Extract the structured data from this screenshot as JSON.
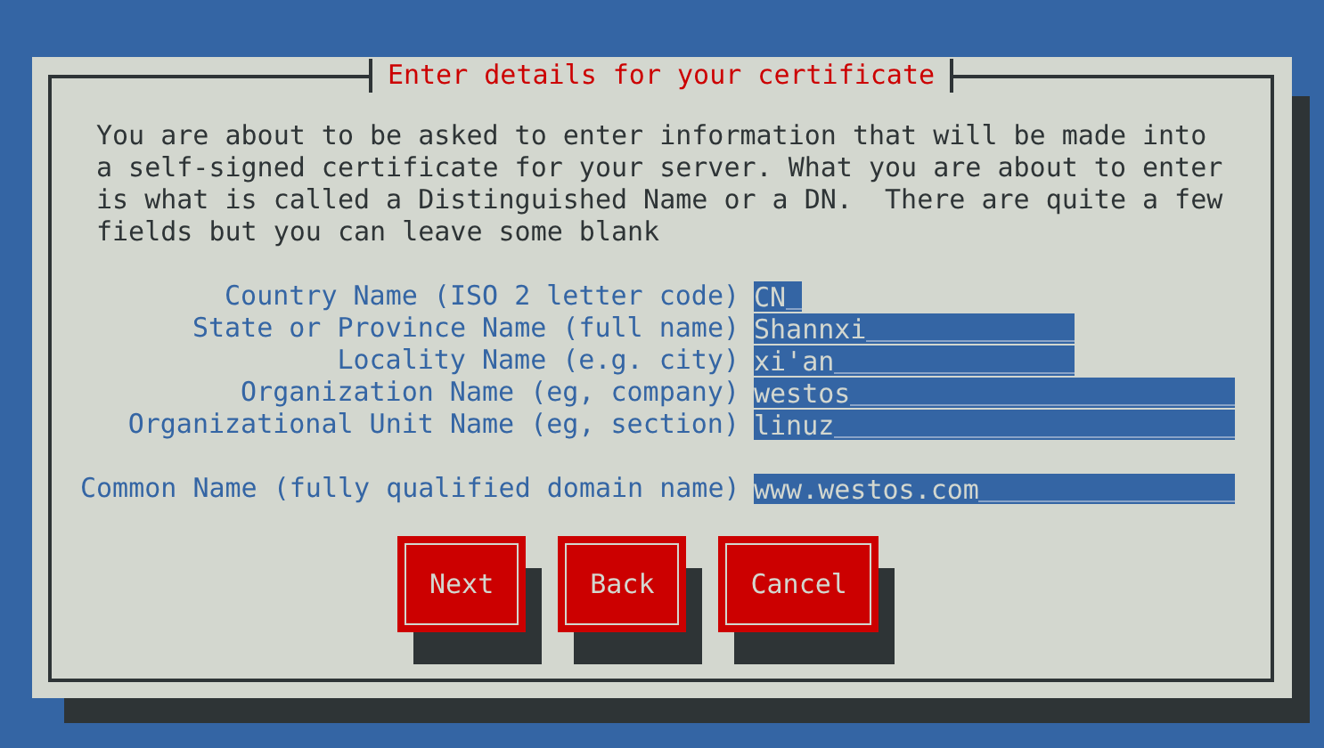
{
  "dialog": {
    "title": "Enter details for your certificate",
    "message": "You are about to be asked to enter information that will be made into\na self-signed certificate for your server. What you are about to enter\nis what is called a Distinguished Name or a DN.  There are quite a few\nfields but you can leave some blank",
    "fields": [
      {
        "label": "Country Name (ISO 2 letter code)",
        "value": "CN"
      },
      {
        "label": "State or Province Name (full name)",
        "value": "Shannxi"
      },
      {
        "label": "Locality Name (e.g. city)",
        "value": "xi'an"
      },
      {
        "label": "Organization Name (eg, company)",
        "value": "westos"
      },
      {
        "label": "Organizational Unit Name (eg, section)",
        "value": "linuz"
      },
      {
        "label": "Common Name (fully qualified domain name)",
        "value": "www.westos.com"
      }
    ],
    "buttons": [
      {
        "label": "Next"
      },
      {
        "label": "Back"
      },
      {
        "label": "Cancel"
      }
    ]
  }
}
